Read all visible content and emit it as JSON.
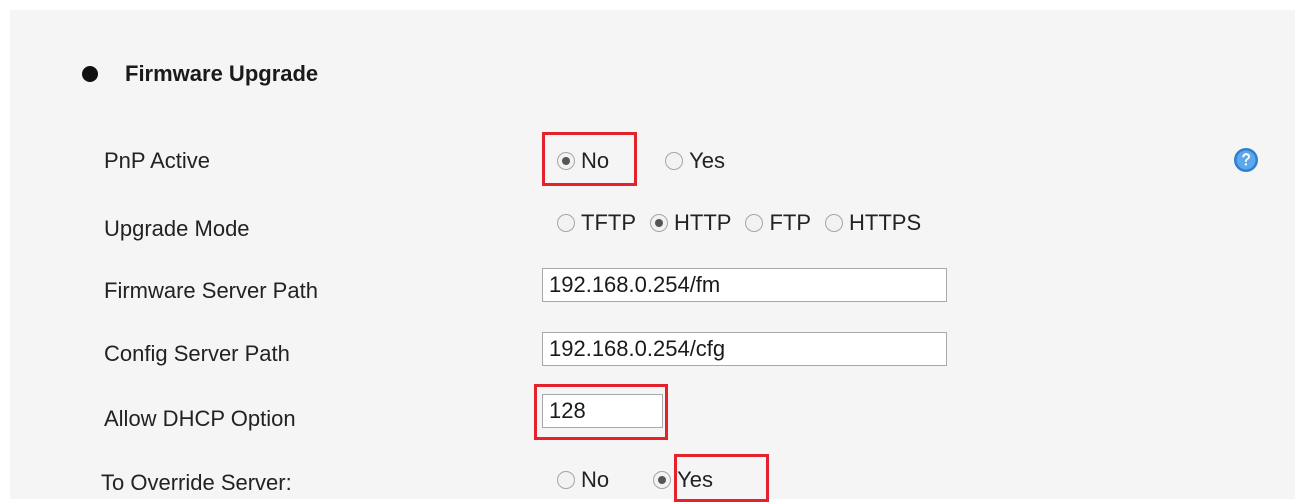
{
  "section": {
    "title": "Firmware Upgrade"
  },
  "rows": {
    "pnp_active": {
      "label": "PnP Active",
      "options": [
        "No",
        "Yes"
      ],
      "selected": "No"
    },
    "upgrade_mode": {
      "label": "Upgrade Mode",
      "options": [
        "TFTP",
        "HTTP",
        "FTP",
        "HTTPS"
      ],
      "selected": "HTTP"
    },
    "firmware_server_path": {
      "label": "Firmware Server Path",
      "value": "192.168.0.254/fm"
    },
    "config_server_path": {
      "label": "Config Server Path",
      "value": "192.168.0.254/cfg"
    },
    "allow_dhcp_option": {
      "label": "Allow DHCP Option",
      "value": "128"
    },
    "to_override_server": {
      "label": "To Override Server:",
      "options": [
        "No",
        "Yes"
      ],
      "selected": "Yes"
    }
  },
  "help": {
    "icon": "question-help-icon"
  },
  "colors": {
    "highlight": "#e3222c",
    "help_icon": "#2f7fd0"
  }
}
